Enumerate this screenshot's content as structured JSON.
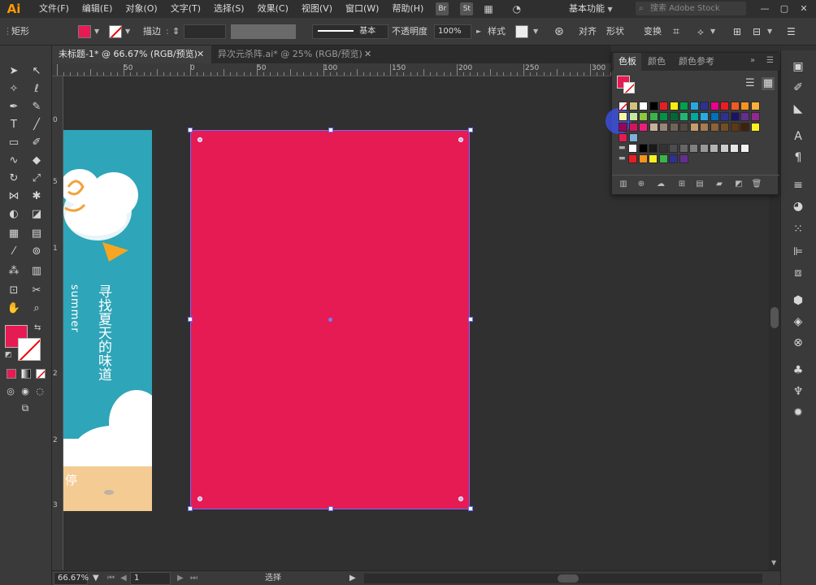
{
  "app": {
    "logo": "Ai"
  },
  "menubar": {
    "items": [
      "文件(F)",
      "编辑(E)",
      "对象(O)",
      "文字(T)",
      "选择(S)",
      "效果(C)",
      "视图(V)",
      "窗口(W)",
      "帮助(H)"
    ],
    "bridge": "Br",
    "stock": "St",
    "workspace": "基本功能",
    "search_placeholder": "搜索 Adobe Stock"
  },
  "controlbar": {
    "object_type": "矩形",
    "fill_color": "#e61b53",
    "stroke_label": "描边",
    "stroke_weight": "",
    "brush_label": "基本",
    "opacity_label": "不透明度",
    "opacity_value": "100%",
    "style_label": "样式",
    "align_label": "对齐",
    "shape_label": "形状",
    "transform_label": "变换"
  },
  "tabs": [
    {
      "label": "未标题-1* @ 66.67% (RGB/预览)",
      "active": true
    },
    {
      "label": "异次元杀阵.ai* @ 25% (RGB/预览)",
      "active": false
    }
  ],
  "ruler_top": [
    "50",
    "0",
    "50",
    "100",
    "150",
    "200",
    "250",
    "300"
  ],
  "ruler_left": [
    "0",
    "5",
    "1",
    "2",
    "2",
    "3"
  ],
  "artboard_prev": {
    "title_text": "寻找夏天的味道",
    "summer_text": "summer",
    "bottom_text": "停"
  },
  "canvas": {
    "main_artboard_color": "#e61b53"
  },
  "statusbar": {
    "zoom": "66.67%",
    "artboard_number": "1",
    "status_text": "选择"
  },
  "swatches_panel": {
    "tabs": [
      "色板",
      "颜色",
      "颜色参考"
    ],
    "active_tab": "色板",
    "colors": [
      [
        "#ffffff",
        "#d4c080",
        "#ffffff",
        "#000000",
        "#e81e25",
        "#f7ec13",
        "#00a14b",
        "#2aa6df",
        "#2e3192",
        "#ec008c",
        "#ed1c24",
        "#f15a24",
        "#f7931e",
        "#fbb03b"
      ],
      [
        "#fff7a0",
        "#c8e6a0",
        "#8dc63f",
        "#39b54a",
        "#009245",
        "#006837",
        "#22b573",
        "#00a99d",
        "#29abe2",
        "#0071bc",
        "#2e3192",
        "#1b1464",
        "#662d91",
        "#93278f"
      ],
      [
        "#9e005d",
        "#d4145a",
        "#ed1e79",
        "#c7b299",
        "#998675",
        "#736357",
        "#534741",
        "#c69c6d",
        "#a67c52",
        "#8c6239",
        "#754c24",
        "#603813",
        "#42210b",
        "#fcee21"
      ],
      [
        "#e61b53",
        "#7fb0d8"
      ],
      [
        "#ffffff",
        "#000000",
        "#1a1a1a",
        "#333333",
        "#4d4d4d",
        "#666666",
        "#808080",
        "#999999",
        "#b3b3b3",
        "#cccccc",
        "#e6e6e6",
        "#f2f2f2"
      ],
      [
        "#ed1c24",
        "#f7931e",
        "#fcee21",
        "#39b54a",
        "#2e3192",
        "#662d91"
      ]
    ]
  },
  "right_strip": {
    "icons": [
      "image-icon",
      "brush-icon",
      "curve-icon",
      "type-icon",
      "paragraph-icon",
      "menu-lines-icon",
      "circle-icon",
      "grid-icon",
      "align-icon",
      "pathfinder-icon",
      "cube-icon",
      "layers-icon",
      "link-icon",
      "club-icon",
      "puppet-icon",
      "sun-icon"
    ]
  }
}
